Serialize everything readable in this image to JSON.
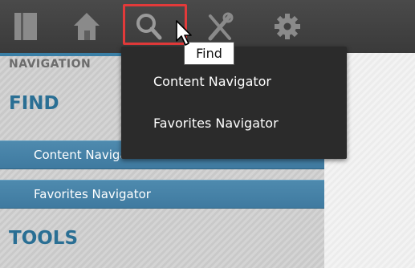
{
  "toolbar": {
    "buttons": [
      {
        "icon": "sidebar-panel-icon"
      },
      {
        "icon": "home-icon"
      },
      {
        "icon": "search-icon",
        "tooltip": "Find"
      },
      {
        "icon": "tools-icon"
      },
      {
        "icon": "gear-icon"
      }
    ]
  },
  "navigation": {
    "title": "NAVIGATION",
    "sections": [
      {
        "heading": "FIND",
        "items": [
          "Content Navigator",
          "Favorites Navigator"
        ]
      },
      {
        "heading": "TOOLS"
      }
    ]
  },
  "dropdown": {
    "items": [
      "Content Navigator",
      "Favorites Navigator"
    ]
  },
  "tooltip": {
    "text": "Find"
  },
  "colors": {
    "toolbar_bg": "#3f3f3f",
    "highlight": "#e23a3a",
    "nav_item_bg": "#4583a7",
    "section_heading": "#2a6f94",
    "dropdown_bg": "#2b2b2b"
  }
}
